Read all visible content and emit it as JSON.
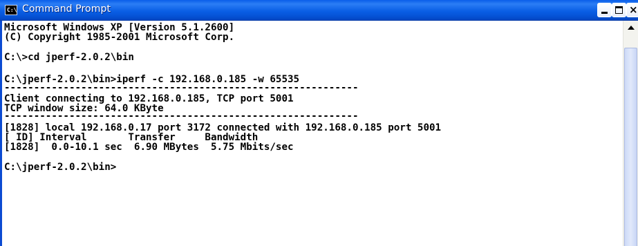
{
  "window": {
    "title": "Command Prompt",
    "icon_label": "C:\\"
  },
  "titlebar_buttons": {
    "minimize": "minimize-icon",
    "maximize": "maximize-icon",
    "close": "close-icon",
    "close_glyph": "×"
  },
  "console": {
    "lines": [
      "Microsoft Windows XP [Version 5.1.2600]",
      "(C) Copyright 1985-2001 Microsoft Corp.",
      "",
      "C:\\>cd jperf-2.0.2\\bin",
      "",
      "C:\\jperf-2.0.2\\bin>iperf -c 192.168.0.185 -w 65535",
      "------------------------------------------------------------",
      "Client connecting to 192.168.0.185, TCP port 5001",
      "TCP window size: 64.0 KByte",
      "------------------------------------------------------------",
      "[1828] local 192.168.0.17 port 3172 connected with 192.168.0.185 port 5001",
      "[ ID] Interval       Transfer     Bandwidth",
      "[1828]  0.0-10.1 sec  6.90 MBytes  5.75 Mbits/sec",
      "",
      "C:\\jperf-2.0.2\\bin>"
    ]
  },
  "colors": {
    "titlebar": "#0a5fe5",
    "console_bg": "#ffffff",
    "console_text": "#000000"
  }
}
